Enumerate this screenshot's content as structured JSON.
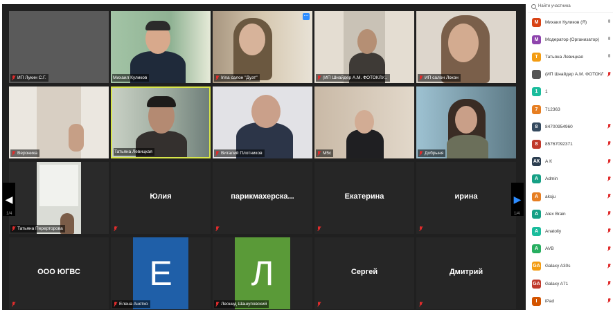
{
  "tiles": [
    {
      "name": "ИП Лукин С.Г.",
      "kind": "photo",
      "bg": "#5a5a5a"
    },
    {
      "name": "Михаил Куликов",
      "kind": "photo",
      "bg": "#9bb8a0"
    },
    {
      "name": "Irina салон \"Дуэт\"",
      "kind": "photo",
      "bg": "#c8b89c"
    },
    {
      "name": "(ИП Шнайдер А.М. ФОТОКЛУ...",
      "kind": "photo",
      "bg": "#d8d0c4"
    },
    {
      "name": "ИП салон Локон",
      "kind": "photo",
      "bg": "#d9d2c8"
    },
    {
      "name": "Вероника",
      "kind": "photo",
      "bg": "#e4e0d8"
    },
    {
      "name": "Татьяна Левицкая",
      "kind": "photo",
      "bg": "#a8b2aa"
    },
    {
      "name": "Виталий Плотников",
      "kind": "photo",
      "bg": "#d0d0d4"
    },
    {
      "name": "M5c",
      "kind": "photo",
      "bg": "#b8aa9c"
    },
    {
      "name": "Добрыня",
      "kind": "photo",
      "bg": "#8fa6b0"
    },
    {
      "name": "Татьяна Перерторова",
      "kind": "photo",
      "bg": "#cfd0cc"
    },
    {
      "name": "Юлия",
      "kind": "text"
    },
    {
      "name": "парикмахерска...",
      "kind": "text"
    },
    {
      "name": "Екатерина",
      "kind": "text"
    },
    {
      "name": "ирина",
      "kind": "text"
    },
    {
      "name": "ООО ЮГВС",
      "kind": "text"
    },
    {
      "name": "Елена Анотко",
      "kind": "letter",
      "letter": "Е",
      "color": "#1f5fa8"
    },
    {
      "name": "Леонид Шашуповский",
      "kind": "letter",
      "letter": "Л",
      "color": "#5a9a38"
    },
    {
      "name": "Сергей",
      "kind": "text"
    },
    {
      "name": "Дмитрий",
      "kind": "text"
    }
  ],
  "nav": {
    "prev_arrow": "◀",
    "next_arrow": "▶",
    "page_left": "1/4",
    "page_right": "1/4"
  },
  "panel": {
    "search_placeholder": "Найти участника",
    "participants": [
      {
        "initials": "М",
        "color": "#d84315",
        "name": "Михаил Куликов (Я)",
        "mic": "grey"
      },
      {
        "initials": "М",
        "color": "#8e44ad",
        "name": "Модератор (Организатор)",
        "mic": "grey"
      },
      {
        "initials": "Т",
        "color": "#f39c12",
        "name": "Татьяна Левицкая",
        "mic": "grey"
      },
      {
        "initials": "",
        "color": "#555555",
        "name": "(ИП Шнайдер А.М. ФОТОКЛУБ...",
        "mic": "red"
      },
      {
        "initials": "1",
        "color": "#1abc9c",
        "name": "1",
        "mic": "none"
      },
      {
        "initials": "7",
        "color": "#e67e22",
        "name": "712363",
        "mic": "none"
      },
      {
        "initials": "8",
        "color": "#34495e",
        "name": "84700954960",
        "mic": "red"
      },
      {
        "initials": "8",
        "color": "#c0392b",
        "name": "85767092371",
        "mic": "red"
      },
      {
        "initials": "АК",
        "color": "#2c3e50",
        "name": "А К",
        "mic": "red"
      },
      {
        "initials": "А",
        "color": "#16a085",
        "name": "Admin",
        "mic": "red"
      },
      {
        "initials": "А",
        "color": "#e67e22",
        "name": "aksju",
        "mic": "red"
      },
      {
        "initials": "А",
        "color": "#16a085",
        "name": "Alex Brain",
        "mic": "red"
      },
      {
        "initials": "А",
        "color": "#1abc9c",
        "name": "Anatoliy",
        "mic": "red"
      },
      {
        "initials": "А",
        "color": "#27ae60",
        "name": "AVB",
        "mic": "red"
      },
      {
        "initials": "GA",
        "color": "#f39c12",
        "name": "Galaxy A30s",
        "mic": "red"
      },
      {
        "initials": "GA",
        "color": "#c0392b",
        "name": "Galaxy A71",
        "mic": "red"
      },
      {
        "initials": "I",
        "color": "#d35400",
        "name": "iPad",
        "mic": "red"
      }
    ]
  }
}
